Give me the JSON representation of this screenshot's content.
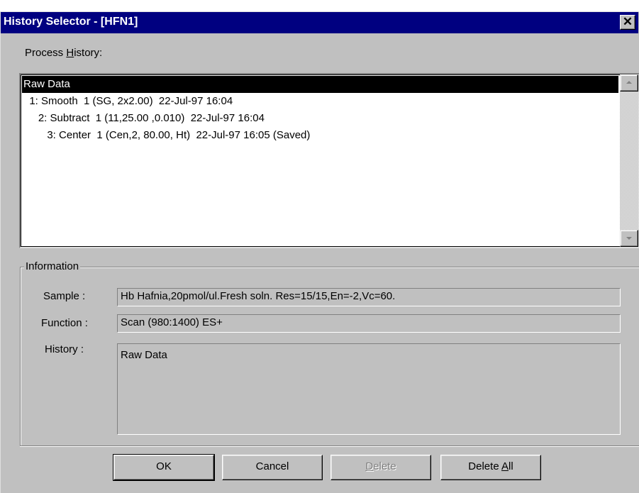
{
  "window": {
    "title": "History Selector - [HFN1]",
    "close_glyph": "✕"
  },
  "process_history": {
    "label_pre": "Process ",
    "label_acc": "H",
    "label_post": "istory:",
    "items": [
      {
        "text": "Raw Data",
        "selected": true
      },
      {
        "text": "  1: Smooth  1 (SG, 2x2.00)  22-Jul-97 16:04",
        "selected": false
      },
      {
        "text": "     2: Subtract  1 (11,25.00 ,0.010)  22-Jul-97 16:04",
        "selected": false
      },
      {
        "text": "        3: Center  1 (Cen,2, 80.00, Ht)  22-Jul-97 16:05 (Saved)",
        "selected": false
      }
    ]
  },
  "information": {
    "legend": "Information",
    "sample_label": "Sample :",
    "sample_value": "Hb Hafnia,20pmol/ul.Fresh soln. Res=15/15,En=-2,Vc=60.",
    "function_label": "Function :",
    "function_value": "Scan (980:1400) ES+",
    "history_label": "History :",
    "history_value": "Raw Data"
  },
  "buttons": {
    "ok": "OK",
    "cancel": "Cancel",
    "delete_acc": "D",
    "delete_rest": "elete",
    "delete_all_pre": "Delete ",
    "delete_all_acc": "A",
    "delete_all_post": "ll"
  }
}
